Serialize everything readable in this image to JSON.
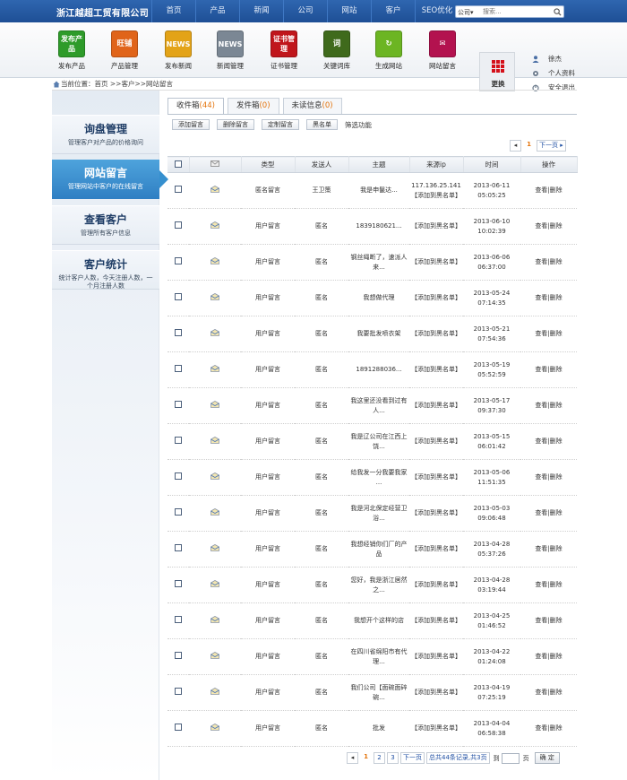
{
  "header": {
    "company": "浙江越超工贸有限公司",
    "nav": [
      "首页",
      "产品",
      "新闻",
      "公司",
      "网站",
      "客户",
      "SEO优化"
    ],
    "search": {
      "scope": "公司",
      "placeholder": "搜索..."
    }
  },
  "toolbar": {
    "items": [
      {
        "label": "发布产品",
        "icon_text": "发布产品",
        "icon": "publish-product-icon",
        "color": "#2e9b2a"
      },
      {
        "label": "产品管理",
        "icon_text": "旺铺",
        "icon": "product-management-icon",
        "color": "#e0641a"
      },
      {
        "label": "发布新闻",
        "icon_text": "NEWS",
        "icon": "publish-news-icon",
        "color": "#e3a318"
      },
      {
        "label": "新闻管理",
        "icon_text": "NEWS",
        "icon": "news-management-icon",
        "color": "#7b8794"
      },
      {
        "label": "证书管理",
        "icon_text": "证书管理",
        "icon": "certificate-management-icon",
        "color": "#c0161c"
      },
      {
        "label": "关键词库",
        "icon_text": "词",
        "icon": "keyword-library-icon",
        "color": "#3f6a1c"
      },
      {
        "label": "生成网站",
        "icon_text": "↻",
        "icon": "generate-site-icon",
        "color": "#6cb523"
      },
      {
        "label": "网站留言",
        "icon_text": "✉",
        "icon": "site-message-icon",
        "color": "#b3124f"
      }
    ],
    "more_label": "更换"
  },
  "user": {
    "name": "徐杰",
    "profile": "个人资料",
    "logout": "安全退出"
  },
  "breadcrumb": "当前位置：首页 >>客户>>网站留言",
  "sidebar": [
    {
      "title": "询盘管理",
      "desc": "管理客户对产品的价格询问",
      "active": false
    },
    {
      "title": "网站留言",
      "desc": "管理网站中客户的在线留言",
      "active": true
    },
    {
      "title": "查看客户",
      "desc": "管理所有客户信息",
      "active": false
    },
    {
      "title": "客户统计",
      "desc": "统计客户人数，今天注册人数，一个月注册人数",
      "active": false
    }
  ],
  "tabs": [
    {
      "label": "收件箱",
      "count": "(44)"
    },
    {
      "label": "发件箱",
      "count": "(0)"
    },
    {
      "label": "未读信息",
      "count": "(0)"
    }
  ],
  "actions": [
    "添加留言",
    "删除留言",
    "定制留言",
    "黑名单"
  ],
  "filter_label": "筛选功能",
  "top_pager": {
    "current": "1",
    "next": "下一页"
  },
  "columns": [
    "类型",
    "发送人",
    "主题",
    "来源ip",
    "时间",
    "操作"
  ],
  "rows": [
    {
      "type": "匿名留言",
      "sender": "王卫策",
      "subject": "我是申鬣达...",
      "ip": "117.136.25.141",
      "ip2": "【添加到黑名单】",
      "date": "2013-06-11",
      "time": "05:05:25"
    },
    {
      "type": "用户留言",
      "sender": "匿名",
      "subject": "1839180621...",
      "ip": "【添加到黑名单】",
      "ip2": "",
      "date": "2013-06-10",
      "time": "10:02:39"
    },
    {
      "type": "用户留言",
      "sender": "匿名",
      "subject": "钢丝绳断了，速派人来...",
      "ip": "【添加到黑名单】",
      "ip2": "",
      "date": "2013-06-06",
      "time": "06:37:00"
    },
    {
      "type": "用户留言",
      "sender": "匿名",
      "subject": "我想做代理",
      "ip": "【添加到黑名单】",
      "ip2": "",
      "date": "2013-05-24",
      "time": "07:14:35"
    },
    {
      "type": "用户留言",
      "sender": "匿名",
      "subject": "我要批发喷衣架",
      "ip": "【添加到黑名单】",
      "ip2": "",
      "date": "2013-05-21",
      "time": "07:54:36"
    },
    {
      "type": "用户留言",
      "sender": "匿名",
      "subject": "1891288036...",
      "ip": "【添加到黑名单】",
      "ip2": "",
      "date": "2013-05-19",
      "time": "05:52:59"
    },
    {
      "type": "用户留言",
      "sender": "匿名",
      "subject": "我这里还没看到过有人...",
      "ip": "【添加到黑名单】",
      "ip2": "",
      "date": "2013-05-17",
      "time": "09:37:30"
    },
    {
      "type": "用户留言",
      "sender": "匿名",
      "subject": "我是辽公司在江西上饶...",
      "ip": "【添加到黑名单】",
      "ip2": "",
      "date": "2013-05-15",
      "time": "06:01:42"
    },
    {
      "type": "用户留言",
      "sender": "匿名",
      "subject": "给我发一分我要我家 ...",
      "ip": "【添加到黑名单】",
      "ip2": "",
      "date": "2013-05-06",
      "time": "11:51:35"
    },
    {
      "type": "用户留言",
      "sender": "匿名",
      "subject": "我是河北保定经营卫浴...",
      "ip": "【添加到黑名单】",
      "ip2": "",
      "date": "2013-05-03",
      "time": "09:06:48"
    },
    {
      "type": "用户留言",
      "sender": "匿名",
      "subject": "我想经销你们厂的产品",
      "ip": "【添加到黑名单】",
      "ip2": "",
      "date": "2013-04-28",
      "time": "05:37:26"
    },
    {
      "type": "用户留言",
      "sender": "匿名",
      "subject": "您好，我是浙江居然之...",
      "ip": "【添加到黑名单】",
      "ip2": "",
      "date": "2013-04-28",
      "time": "03:19:44"
    },
    {
      "type": "用户留言",
      "sender": "匿名",
      "subject": "我想开个这样的店",
      "ip": "【添加到黑名单】",
      "ip2": "",
      "date": "2013-04-25",
      "time": "01:46:52"
    },
    {
      "type": "用户留言",
      "sender": "匿名",
      "subject": "在四川省绵阳市有代理...",
      "ip": "【添加到黑名单】",
      "ip2": "",
      "date": "2013-04-22",
      "time": "01:24:08"
    },
    {
      "type": "用户留言",
      "sender": "匿名",
      "subject": "我们公司【面碗面碎碗...",
      "ip": "【添加到黑名单】",
      "ip2": "",
      "date": "2013-04-19",
      "time": "07:25:19"
    },
    {
      "type": "用户留言",
      "sender": "匿名",
      "subject": "批发",
      "ip": "【添加到黑名单】",
      "ip2": "",
      "date": "2013-04-04",
      "time": "06:58:38"
    }
  ],
  "row_actions": {
    "view": "查看",
    "sep": "|",
    "del": "删除"
  },
  "bottom_pager": {
    "pages": [
      "1",
      "2",
      "3"
    ],
    "next": "下一页",
    "info": "总共44条记录,共3页",
    "goto_prefix": "到",
    "goto_suffix": "页",
    "confirm": "确 定"
  }
}
